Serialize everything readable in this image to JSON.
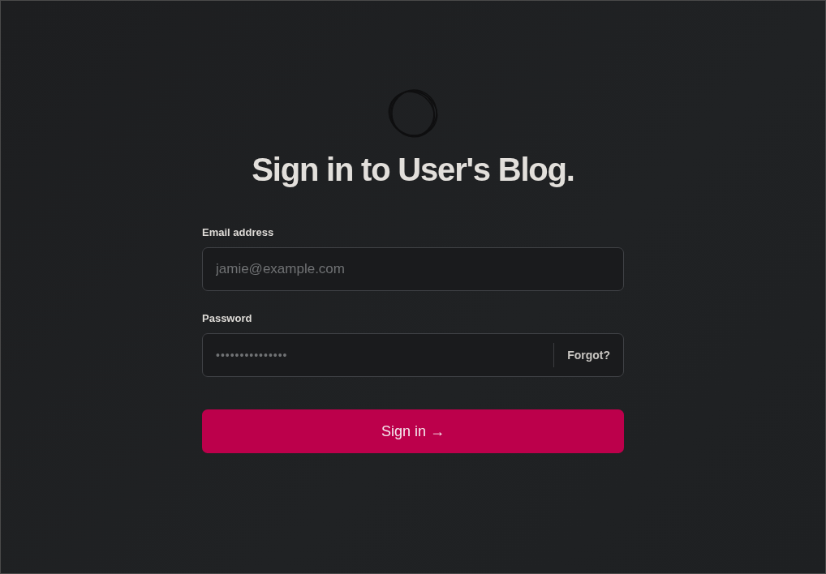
{
  "title": "Sign in to User's Blog.",
  "fields": [
    {
      "label": "Email address",
      "placeholder": "jamie@example.com",
      "kind": "email"
    },
    {
      "label": "Password",
      "placeholder": "•••••••••••••••",
      "kind": "password",
      "action": "Forgot?"
    }
  ],
  "submit": "Sign in →"
}
